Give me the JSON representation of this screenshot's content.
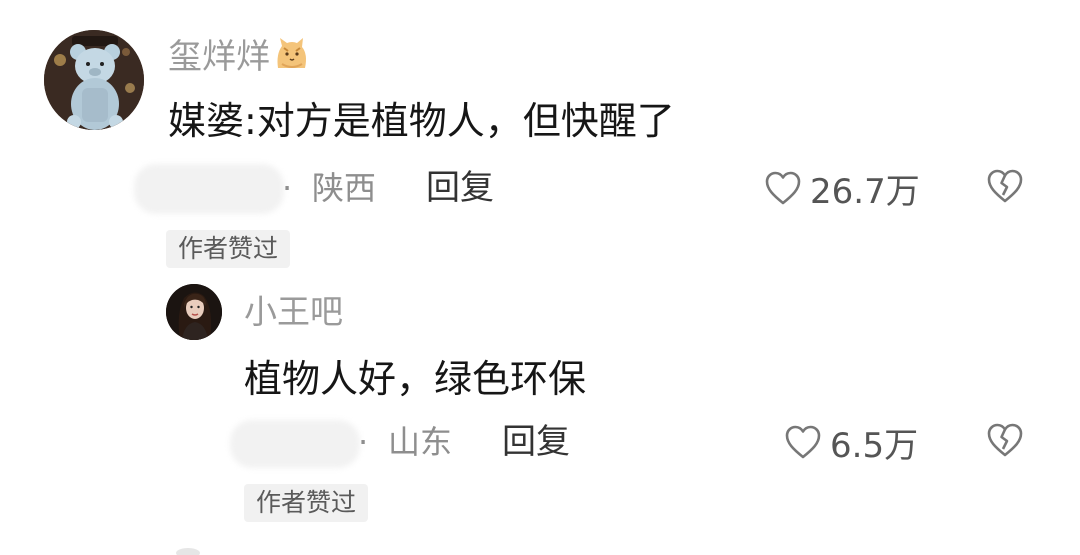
{
  "comment": {
    "username": "玺烊烊",
    "username_emoji_icon": "cat-icon",
    "avatar_icon": "teddy-bear-avatar",
    "content": "媒婆:对方是植物人，但快醒了",
    "meta": {
      "dot": "·",
      "location": "陕西"
    },
    "reply_label": "回复",
    "like_count": "26.7万",
    "author_liked_tag": "作者赞过",
    "colors": {
      "meta": "#8e8e8e",
      "username": "#9a9a9a",
      "tag_bg": "#f1f1f1"
    }
  },
  "reply": {
    "username": "小王吧",
    "avatar_icon": "woman-portrait-avatar",
    "content": "植物人好，绿色环保",
    "meta": {
      "dot": "·",
      "location": "山东"
    },
    "reply_label": "回复",
    "like_count": "6.5万",
    "author_liked_tag": "作者赞过"
  }
}
